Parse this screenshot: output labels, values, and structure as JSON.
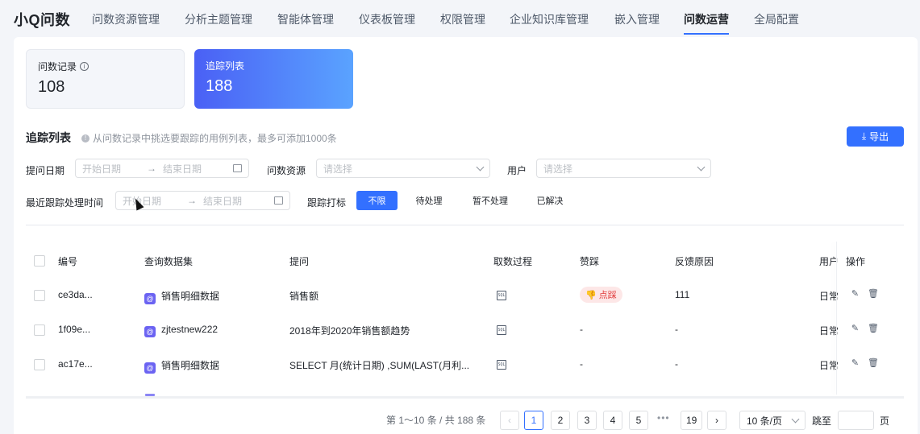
{
  "app": {
    "brand": "小Q问数"
  },
  "nav": {
    "items": [
      "问数资源管理",
      "分析主题管理",
      "智能体管理",
      "仪表板管理",
      "权限管理",
      "企业知识库管理",
      "嵌入管理",
      "问数运营",
      "全局配置"
    ]
  },
  "stats": {
    "records": {
      "label": "问数记录",
      "value": "108"
    },
    "tracking": {
      "label": "追踪列表",
      "value": "188"
    }
  },
  "section": {
    "title": "追踪列表",
    "desc": "从问数记录中挑选要跟踪的用例列表，最多可添加1000条",
    "export_label": "导出"
  },
  "filters": {
    "ask_date_label": "提问日期",
    "start_placeholder": "开始日期",
    "end_placeholder": "结束日期",
    "resource_label": "问数资源",
    "select_placeholder": "请选择",
    "user_label": "用户",
    "track_time_label": "最近跟踪处理时间",
    "track_mark_label": "跟踪打标",
    "mark_options": [
      "不限",
      "待处理",
      "暂不处理",
      "已解决"
    ],
    "mark_selected": "不限"
  },
  "table": {
    "headers": [
      "编号",
      "查询数据集",
      "提问",
      "取数过程",
      "赞踩",
      "反馈原因",
      "用户",
      "操作"
    ],
    "rows": [
      {
        "id": "ce3da...",
        "dataset": "销售明细数据",
        "question": "销售额",
        "vote": "点踩",
        "reason": "111",
        "user": "日常"
      },
      {
        "id": "1f09e...",
        "dataset": "zjtestnew222",
        "question": "2018年到2020年销售额趋势",
        "vote": "-",
        "reason": "-",
        "user": "日常"
      },
      {
        "id": "ac17e...",
        "dataset": "销售明细数据",
        "question": "SELECT 月(统计日期) ,SUM(LAST(月利...",
        "vote": "-",
        "reason": "-",
        "user": "日常"
      }
    ]
  },
  "pagination": {
    "total_text": "第 1～10 条 / 共 188 条",
    "pages": [
      "1",
      "2",
      "3",
      "4",
      "5"
    ],
    "last_page": "19",
    "dots": "•••",
    "current": "1",
    "page_size": "10 条/页",
    "jump_label": "跳至",
    "page_suffix": "页"
  },
  "colors": {
    "primary": "#3370ff",
    "downvote_bg": "#fde7e7",
    "downvote_text": "#e13e3e"
  }
}
